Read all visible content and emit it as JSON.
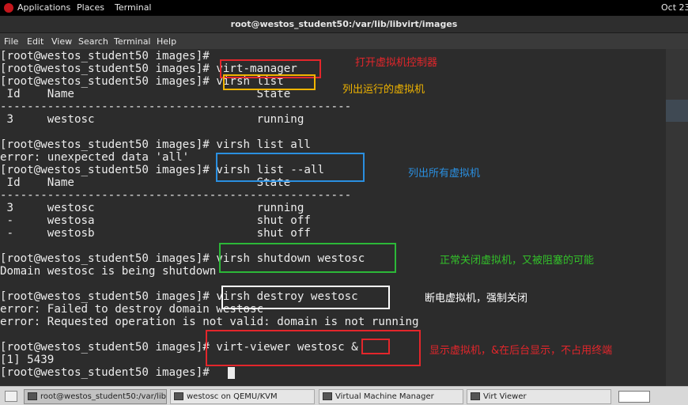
{
  "topbar": {
    "applications": "Applications",
    "places": "Places",
    "terminal": "Terminal",
    "clock": "Oct 23"
  },
  "window": {
    "title": "root@westos_student50:/var/lib/libvirt/images"
  },
  "menu": [
    "File",
    "Edit",
    "View",
    "Search",
    "Terminal",
    "Help"
  ],
  "terminal_lines": [
    "[root@westos_student50 images]#",
    "[root@westos_student50 images]# virt-manager",
    "[root@westos_student50 images]# virsh list",
    " Id    Name                           State",
    "----------------------------------------------------",
    " 3     westosc                        running",
    "",
    "[root@westos_student50 images]# virsh list all",
    "error: unexpected data 'all'",
    "[root@westos_student50 images]# virsh list --all",
    " Id    Name                           State",
    "----------------------------------------------------",
    " 3     westosc                        running",
    " -     westosa                        shut off",
    " -     westosb                        shut off",
    "",
    "[root@westos_student50 images]# virsh shutdown westosc",
    "Domain westosc is being shutdown",
    "",
    "[root@westos_student50 images]# virsh destroy westosc",
    "error: Failed to destroy domain westosc",
    "error: Requested operation is not valid: domain is not running",
    "",
    "[root@westos_student50 images]# virt-viewer westosc &",
    "[1] 5439",
    "[root@westos_student50 images]#"
  ],
  "annotations": {
    "virt_manager": "打开虚拟机控制器",
    "virsh_list": "列出运行的虚拟机",
    "virsh_list_all": "列出所有虚拟机",
    "shutdown": "正常关闭虚拟机，又被阻塞的可能",
    "destroy": "断电虚拟机，强制关闭",
    "viewer": "显示虚拟机，&在后台显示，不占用终端"
  },
  "colors": {
    "red": "#e3262b",
    "orange": "#f0b400",
    "blue": "#2a8fe0",
    "green": "#2cb838",
    "white": "#ffffff",
    "text_green": "#33c02a"
  },
  "taskbar": [
    "root@westos_student50:/var/lib...",
    "westosc on QEMU/KVM",
    "Virtual Machine Manager",
    "Virt Viewer"
  ]
}
